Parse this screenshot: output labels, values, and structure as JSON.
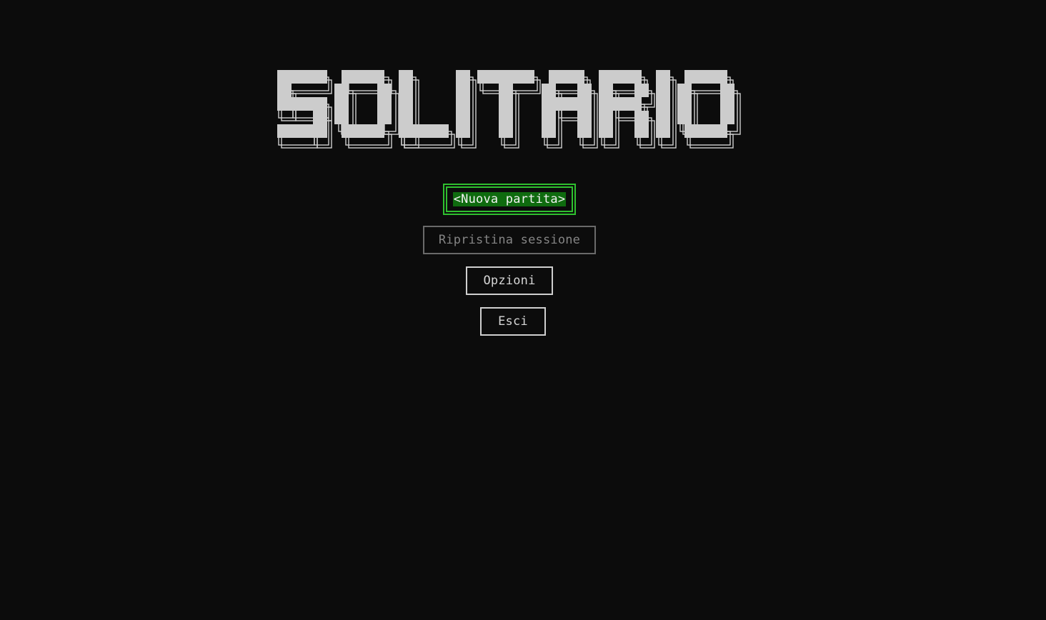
{
  "app": {
    "title": "SOLITARIO"
  },
  "colors": {
    "background": "#0c0c0c",
    "logo_fill": "#cccccc",
    "focus_border": "#2fc02f",
    "focus_highlight": "#0f6b0f",
    "disabled_border": "#6a6a6a"
  },
  "menu": {
    "new_game": "<Nuova partita>",
    "restore_session": "Ripristina sessione",
    "options": "Opzioni",
    "exit": "Esci"
  }
}
